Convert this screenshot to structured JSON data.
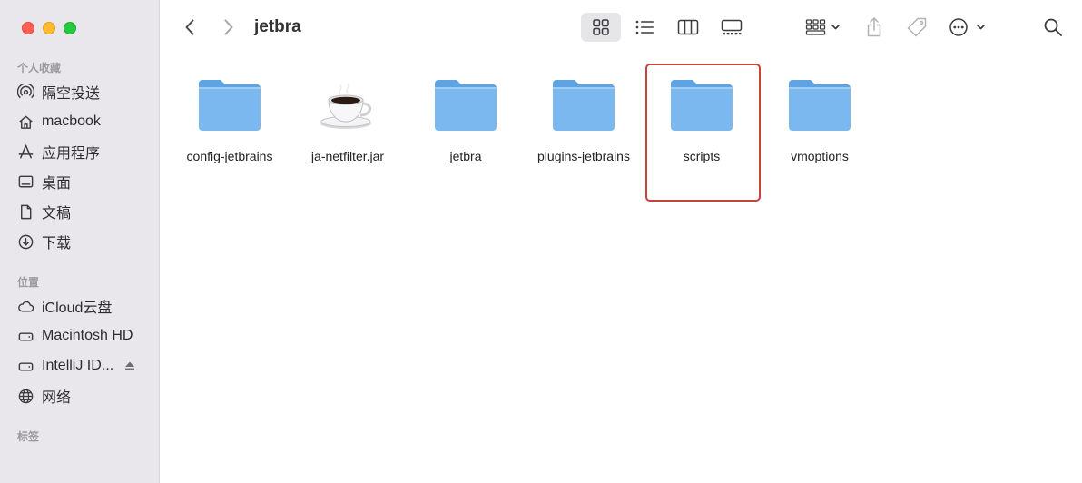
{
  "window": {
    "title": "jetbra"
  },
  "sidebar": {
    "sections": [
      {
        "title": "个人收藏",
        "items": [
          {
            "label": "隔空投送",
            "icon": "airdrop-icon"
          },
          {
            "label": "macbook",
            "icon": "home-icon"
          },
          {
            "label": "应用程序",
            "icon": "applications-icon"
          },
          {
            "label": "桌面",
            "icon": "desktop-icon"
          },
          {
            "label": "文稿",
            "icon": "document-icon"
          },
          {
            "label": "下载",
            "icon": "download-icon"
          }
        ]
      },
      {
        "title": "位置",
        "items": [
          {
            "label": "iCloud云盘",
            "icon": "cloud-icon"
          },
          {
            "label": "Macintosh HD",
            "icon": "drive-icon"
          },
          {
            "label": "IntelliJ ID...",
            "icon": "drive-icon",
            "eject": true
          },
          {
            "label": "网络",
            "icon": "globe-icon"
          }
        ]
      },
      {
        "title": "标签",
        "items": []
      }
    ]
  },
  "toolbar": {
    "back": "chevron-left-icon",
    "forward": "chevron-right-icon",
    "view_modes": [
      "icon-view",
      "list-view",
      "column-view",
      "gallery-view"
    ],
    "active_view": "icon-view",
    "group": "group-icon",
    "share": "share-icon",
    "tag": "tag-icon",
    "more": "ellipsis-icon",
    "search": "search-icon"
  },
  "files": [
    {
      "name": "config-jetbrains",
      "type": "folder"
    },
    {
      "name": "ja-netfilter.jar",
      "type": "jar"
    },
    {
      "name": "jetbra",
      "type": "folder"
    },
    {
      "name": "plugins-jetbrains",
      "type": "folder"
    },
    {
      "name": "scripts",
      "type": "folder",
      "highlighted": true
    },
    {
      "name": "vmoptions",
      "type": "folder"
    }
  ],
  "colors": {
    "folder": "#7ab8ef",
    "folder_tab": "#5fa3e3",
    "highlight": "#c8433a",
    "sidebar_bg": "#e9e7eb"
  }
}
